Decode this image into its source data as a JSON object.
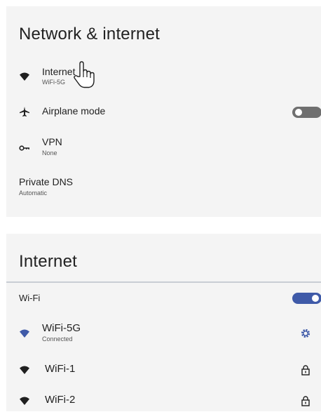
{
  "network": {
    "title": "Network & internet",
    "items": [
      {
        "label": "Internet",
        "sub": "WiFi-5G",
        "icon": "wifi-icon"
      },
      {
        "label": "Airplane mode",
        "icon": "airplane-icon",
        "toggle_on": false
      },
      {
        "label": "VPN",
        "sub": "None",
        "icon": "key-icon"
      },
      {
        "label": "Private DNS",
        "sub": "Automatic"
      }
    ]
  },
  "internet": {
    "title": "Internet",
    "wifi_label": "Wi-Fi",
    "wifi_toggle_on": true,
    "networks": [
      {
        "name": "WiFi-5G",
        "status": "Connected",
        "icon": "gear-icon"
      },
      {
        "name": "WiFi-1",
        "icon": "lock-icon"
      },
      {
        "name": "WiFi-2",
        "icon": "lock-icon"
      }
    ]
  },
  "colors": {
    "panel_bg": "#f4f4f4",
    "accent": "#3f5aa8",
    "toggle_off": "#6f6f6f",
    "divider": "#c9cdd4"
  }
}
